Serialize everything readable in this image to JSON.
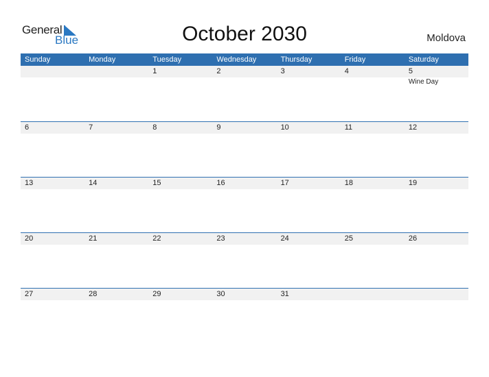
{
  "logo": {
    "general": "General",
    "blue": "Blue"
  },
  "title": "October 2030",
  "country": "Moldova",
  "weekdays": [
    "Sunday",
    "Monday",
    "Tuesday",
    "Wednesday",
    "Thursday",
    "Friday",
    "Saturday"
  ],
  "weeks": [
    {
      "days": [
        "",
        "",
        "1",
        "2",
        "3",
        "4",
        "5"
      ],
      "events": [
        "",
        "",
        "",
        "",
        "",
        "",
        "Wine Day"
      ]
    },
    {
      "days": [
        "6",
        "7",
        "8",
        "9",
        "10",
        "11",
        "12"
      ],
      "events": [
        "",
        "",
        "",
        "",
        "",
        "",
        ""
      ]
    },
    {
      "days": [
        "13",
        "14",
        "15",
        "16",
        "17",
        "18",
        "19"
      ],
      "events": [
        "",
        "",
        "",
        "",
        "",
        "",
        ""
      ]
    },
    {
      "days": [
        "20",
        "21",
        "22",
        "23",
        "24",
        "25",
        "26"
      ],
      "events": [
        "",
        "",
        "",
        "",
        "",
        "",
        ""
      ]
    },
    {
      "days": [
        "27",
        "28",
        "29",
        "30",
        "31",
        "",
        ""
      ],
      "events": [
        "",
        "",
        "",
        "",
        "",
        "",
        ""
      ]
    }
  ],
  "colors": {
    "accent": "#2e6fb0",
    "logo_blue": "#2a78c2",
    "strip": "#f1f1f1"
  }
}
